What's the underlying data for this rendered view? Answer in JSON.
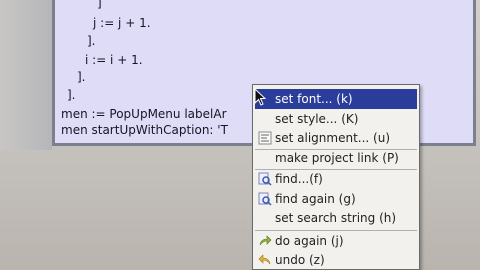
{
  "code": {
    "lines": [
      "]",
      "j := j + 1.",
      "].",
      "i := i + 1.",
      "].",
      "].",
      "men := PopUpMenu  labelAr",
      "men startUpWithCaption: 'T"
    ]
  },
  "context_menu": {
    "items": [
      {
        "label": "set font... (k)",
        "icon": "none",
        "selected": true
      },
      {
        "label": "set style... (K)",
        "icon": "none"
      },
      {
        "label": "set alignment... (u)",
        "icon": "align-icon"
      },
      {
        "label": "make project link (P)",
        "icon": "none"
      },
      {
        "label": "find...(f)",
        "icon": "find-icon"
      },
      {
        "label": "find again (g)",
        "icon": "find-again-icon"
      },
      {
        "label": "set search string (h)",
        "icon": "none"
      },
      {
        "label": "do again (j)",
        "icon": "redo-arrow-icon"
      },
      {
        "label": "undo (z)",
        "icon": "undo-arrow-icon"
      }
    ]
  },
  "colors": {
    "editor_bg": "#dedcf7",
    "menu_bg": "#f2f1ee",
    "selection": "#2a3d9a"
  }
}
